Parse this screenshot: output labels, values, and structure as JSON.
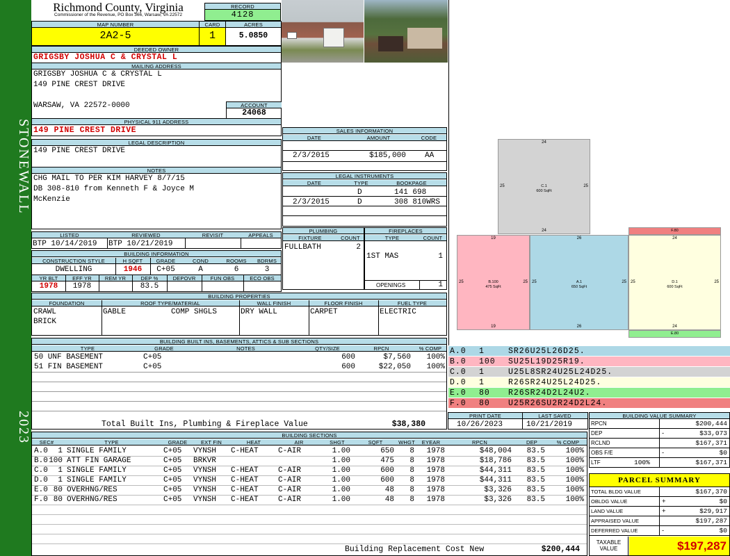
{
  "header": {
    "county": "Richmond County, Virginia",
    "commissioner": "Commissioner of the Revenue, PO Box 366, Warsaw, VA 22572",
    "record_label": "RECORD",
    "record": "4128",
    "map_label": "MAP NUMBER",
    "map": "2A2-5",
    "card_label": "CARD",
    "card": "1",
    "acres_label": "ACRES",
    "acres": "5.0850"
  },
  "sidebar": {
    "district": "STONEWALL",
    "year": "2023"
  },
  "owner": {
    "deeded_label": "DEEDED OWNER",
    "deeded": "GRIGSBY JOSHUA C & CRYSTAL L",
    "mailing_label": "MAILING ADDRESS",
    "mail1": "GRIGSBY JOSHUA C & CRYSTAL L",
    "mail2": "149 PINE CREST DRIVE",
    "mail3": "WARSAW, VA 22572-0000",
    "account_label": "ACCOUNT",
    "account": "24068",
    "physical_label": "PHYSICAL 911 ADDRESS",
    "physical": "149 PINE CREST DRIVE",
    "legal_label": "LEGAL DESCRIPTION",
    "legal": "149 PINE CREST DRIVE",
    "notes_label": "NOTES",
    "note1": "CHG MAIL TO PER  KIM HARVEY 8/7/15",
    "note2": "DB 308-810 from Kenneth F & Joyce M",
    "note3": "McKenzie"
  },
  "review": {
    "listed_label": "LISTED",
    "listed": "BTP 10/14/2019",
    "reviewed_label": "REVIEWED",
    "reviewed": "BTP 10/21/2019",
    "revisit_label": "REVISIT",
    "appeals_label": "APPEALS"
  },
  "building_info": {
    "label": "BUILDING INFORMATION",
    "h": [
      "CONSTRUCTION STYLE",
      "H SQFT",
      "GRADE",
      "COND",
      "ROOMS",
      "BDRMS"
    ],
    "style": "DWELLING",
    "hsqft": "1946",
    "grade": "C+05",
    "cond": "A",
    "rooms": "6",
    "bdrms": "3",
    "h2": [
      "YR BLT",
      "EFF YR",
      "REM YR",
      "DEP %",
      "DEPOVR",
      "FUN OBS",
      "ECO OBS"
    ],
    "yrblt": "1978",
    "effyr": "1978",
    "dep": "83.5"
  },
  "sales": {
    "label": "SALES INFORMATION",
    "h": [
      "DATE",
      "AMOUNT",
      "CODE"
    ],
    "date": "2/3/2015",
    "amount": "$185,000",
    "code": "AA"
  },
  "legal_inst": {
    "label": "LEGAL INSTRUMENTS",
    "h": [
      "DATE",
      "TYPE",
      "BOOKPAGE"
    ],
    "rows": [
      {
        "date": "",
        "type": "D",
        "bp": "141 698"
      },
      {
        "date": "2/3/2015",
        "type": "D",
        "bp": "308 810WRS"
      }
    ]
  },
  "plumbing": {
    "label": "PLUMBING",
    "h": [
      "FIXTURE",
      "COUNT"
    ],
    "fixture": "FULLBATH",
    "count": "2"
  },
  "fireplaces": {
    "label": "FIREPLACES",
    "h": [
      "TYPE",
      "COUNT"
    ],
    "type": "1ST MAS",
    "count": "1",
    "openings_label": "OPENINGS",
    "openings": "1"
  },
  "props": {
    "label": "BUILDING PROPERTIES",
    "h": [
      "FOUNDATION",
      "ROOF TYPE/MATERIAL",
      "WALL FINISH",
      "FLOOR FINISH",
      "FUEL TYPE"
    ],
    "found1": "CRAWL",
    "found2": "BRICK",
    "roof1": "GABLE",
    "roof2": "COMP SHGLS",
    "wall": "DRY WALL",
    "floor": "CARPET",
    "fuel": "ELECTRIC"
  },
  "builtins": {
    "label": "BUILDING BUILT INS, BASEMENTS, ATTICS & SUB SECTIONS",
    "h": [
      "TYPE",
      "GRADE",
      "NOTES",
      "QTY/SIZE",
      "RPCN",
      "% COMP"
    ],
    "rows": [
      {
        "type": "50 UNF BASEMENT",
        "grade": "C+05",
        "qty": "600",
        "rpcn": "$7,560",
        "pct": "100%"
      },
      {
        "type": "51 FIN BASEMENT",
        "grade": "C+05",
        "qty": "600",
        "rpcn": "$22,050",
        "pct": "100%"
      }
    ],
    "total_label": "Total Built Ins, Plumbing & Fireplace Value",
    "total": "$38,380"
  },
  "dates": {
    "print_label": "PRINT DATE",
    "print": "10/26/2023",
    "saved_label": "LAST SAVED",
    "saved": "10/21/2019"
  },
  "sections": {
    "label": "BUILDING SECTIONS",
    "h": [
      "SEC#",
      "TYPE",
      "GRADE",
      "EXT FIN",
      "HEAT",
      "AIR",
      "SHGT",
      "SQFT",
      "WHGT",
      "EYEAR",
      "RPCN",
      "DEP",
      "% COMP"
    ],
    "rows": [
      {
        "sec": "A.0",
        "n": "1",
        "type": "SINGLE FAMILY",
        "grade": "C+05",
        "ext": "VYNSH",
        "heat": "C-HEAT",
        "air": "C-AIR",
        "shgt": "1.00",
        "sqft": "650",
        "whgt": "8",
        "eyear": "1978",
        "rpcn": "$48,004",
        "dep": "83.5",
        "pct": "100%"
      },
      {
        "sec": "B.0",
        "n": "100",
        "type": "ATT FIN GARAGE",
        "grade": "C+05",
        "ext": "BRKVR",
        "heat": "",
        "air": "",
        "shgt": "1.00",
        "sqft": "475",
        "whgt": "8",
        "eyear": "1978",
        "rpcn": "$18,786",
        "dep": "83.5",
        "pct": "100%"
      },
      {
        "sec": "C.0",
        "n": "1",
        "type": "SINGLE FAMILY",
        "grade": "C+05",
        "ext": "VYNSH",
        "heat": "C-HEAT",
        "air": "C-AIR",
        "shgt": "1.00",
        "sqft": "600",
        "whgt": "8",
        "eyear": "1978",
        "rpcn": "$44,311",
        "dep": "83.5",
        "pct": "100%"
      },
      {
        "sec": "D.0",
        "n": "1",
        "type": "SINGLE FAMILY",
        "grade": "C+05",
        "ext": "VYNSH",
        "heat": "C-HEAT",
        "air": "C-AIR",
        "shgt": "1.00",
        "sqft": "600",
        "whgt": "8",
        "eyear": "1978",
        "rpcn": "$44,311",
        "dep": "83.5",
        "pct": "100%"
      },
      {
        "sec": "E.0",
        "n": "80",
        "type": "OVERHNG/RES",
        "grade": "C+05",
        "ext": "VYNSH",
        "heat": "C-HEAT",
        "air": "C-AIR",
        "shgt": "1.00",
        "sqft": "48",
        "whgt": "8",
        "eyear": "1978",
        "rpcn": "$3,326",
        "dep": "83.5",
        "pct": "100%"
      },
      {
        "sec": "F.0",
        "n": "80",
        "type": "OVERHNG/RES",
        "grade": "C+05",
        "ext": "VYNSH",
        "heat": "C-HEAT",
        "air": "C-AIR",
        "shgt": "1.00",
        "sqft": "48",
        "whgt": "8",
        "eyear": "1978",
        "rpcn": "$3,326",
        "dep": "83.5",
        "pct": "100%"
      }
    ],
    "brcn_label": "Building Replacement Cost New",
    "brcn": "$200,444"
  },
  "sketch": {
    "c": {
      "name": "C.1",
      "area": "600 SqFt",
      "top": "24",
      "bottom": "24",
      "left": "25",
      "right": "25"
    },
    "b": {
      "name": "B.100",
      "area": "475 SqFt",
      "top": "19",
      "bottom": "19",
      "left": "25",
      "right": "25"
    },
    "a": {
      "name": "A.1",
      "area": "650 SqFt",
      "top": "26",
      "bottom": "26",
      "left": "25",
      "right": "25"
    },
    "d": {
      "name": "D.1",
      "area": "600 SqFt",
      "top": "24",
      "bottom": "24",
      "left": "25",
      "right": "25"
    },
    "f": "F.80",
    "e": "E.80"
  },
  "vectors": [
    {
      "sec": "A.0",
      "n": "1",
      "v": "SR26U25L26D25.",
      "color": "#add8e6"
    },
    {
      "sec": "B.0",
      "n": "100",
      "v": "SU25L19D25R19.",
      "color": "#ffb6c1"
    },
    {
      "sec": "C.0",
      "n": "1",
      "v": "U25L8SR24U25L24D25.",
      "color": "#d3d3d3"
    },
    {
      "sec": "D.0",
      "n": "1",
      "v": "R26SR24U25L24D25.",
      "color": "#ffffe0"
    },
    {
      "sec": "E.0",
      "n": "80",
      "v": "R26SR24D2L24U2.",
      "color": "#90ee90"
    },
    {
      "sec": "F.0",
      "n": "80",
      "v": "U25R26SU2R24D2L24.",
      "color": "#f08080"
    }
  ],
  "value_summary": {
    "label": "BUILDING VALUE SUMMARY",
    "rpcn_l": "RPCN",
    "rpcn": "$200,444",
    "dep_l": "DEP",
    "dep_s": "-",
    "dep": "$33,073",
    "rclnd_l": "RCLND",
    "rclnd": "$167,371",
    "obs_l": "OBS F/E",
    "obs_s": "-",
    "obs": "$0",
    "ltf_l": "LTF",
    "ltf_pct": "100%",
    "ltf": "$167,371"
  },
  "parcel": {
    "label": "PARCEL SUMMARY",
    "tbv_l": "TOTAL BLDG VALUE",
    "tbv": "$167,370",
    "obldg_l": "OBLDG VALUE",
    "obldg_s": "+",
    "obldg": "$0",
    "land_l": "LAND VALUE",
    "land_s": "+",
    "land": "$29,917",
    "appr_l": "APPRAISED VALUE",
    "appr": "$197,287",
    "def_l": "DEFERRED VALUE",
    "def_s": "-",
    "def": "$0",
    "tax_l1": "TAXABLE",
    "tax_l2": "VALUE",
    "tax": "$197,287"
  }
}
